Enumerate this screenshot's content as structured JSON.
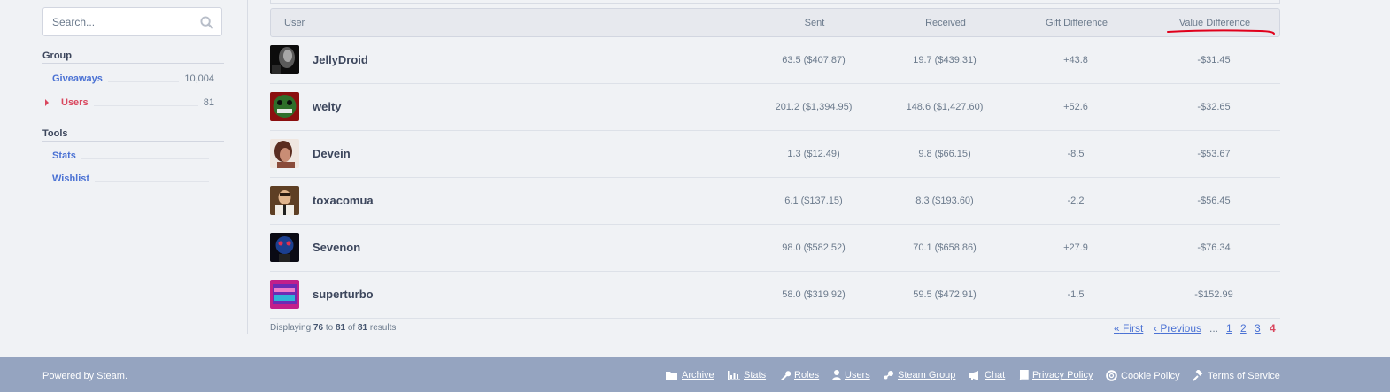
{
  "search": {
    "placeholder": "Search..."
  },
  "sidebar": {
    "group_heading": "Group",
    "group_items": [
      {
        "label": "Giveaways",
        "count": "10,004"
      },
      {
        "label": "Users",
        "count": "81"
      }
    ],
    "tools_heading": "Tools",
    "tools_items": [
      {
        "label": "Stats"
      },
      {
        "label": "Wishlist"
      }
    ]
  },
  "table": {
    "headers": {
      "user": "User",
      "sent": "Sent",
      "received": "Received",
      "gift_difference": "Gift Difference",
      "value_difference": "Value Difference"
    },
    "rows": [
      {
        "user": "JellyDroid",
        "sent": "63.5 ($407.87)",
        "received": "19.7 ($439.31)",
        "gift_diff": "+43.8",
        "value_diff": "-$31.45"
      },
      {
        "user": "weity",
        "sent": "201.2 ($1,394.95)",
        "received": "148.6 ($1,427.60)",
        "gift_diff": "+52.6",
        "value_diff": "-$32.65"
      },
      {
        "user": "Devein",
        "sent": "1.3 ($12.49)",
        "received": "9.8 ($66.15)",
        "gift_diff": "-8.5",
        "value_diff": "-$53.67"
      },
      {
        "user": "toxacomua",
        "sent": "6.1 ($137.15)",
        "received": "8.3 ($193.60)",
        "gift_diff": "-2.2",
        "value_diff": "-$56.45"
      },
      {
        "user": "Sevenon",
        "sent": "98.0 ($582.52)",
        "received": "70.1 ($658.86)",
        "gift_diff": "+27.9",
        "value_diff": "-$76.34"
      },
      {
        "user": "superturbo",
        "sent": "58.0 ($319.92)",
        "received": "59.5 ($472.91)",
        "gift_diff": "-1.5",
        "value_diff": "-$152.99"
      }
    ]
  },
  "results": {
    "prefix": "Displaying",
    "from": "76",
    "to_word": "to",
    "to": "81",
    "of_word": "of",
    "total": "81",
    "suffix": "results"
  },
  "pagination": {
    "first": "First",
    "previous": "Previous",
    "dots": "...",
    "pages": [
      "1",
      "2",
      "3",
      "4"
    ],
    "current": "4"
  },
  "footer": {
    "powered_prefix": "Powered by",
    "powered_link": "Steam",
    "powered_suffix": ".",
    "links": [
      "Archive",
      "Stats",
      "Roles",
      "Users",
      "Steam Group",
      "Chat",
      "Privacy Policy",
      "Cookie Policy",
      "Terms of Service"
    ]
  },
  "icons": {
    "search": "search-icon",
    "archive": "folder-icon",
    "stats": "bar-chart-icon",
    "roles": "wrench-icon",
    "users": "user-icon",
    "steam_group": "steam-icon",
    "chat": "megaphone-icon",
    "privacy": "book-icon",
    "cookie": "lifebuoy-icon",
    "terms": "gavel-icon",
    "first": "double-chevron-left-icon",
    "previous": "chevron-left-icon"
  },
  "colors": {
    "link": "#4b72d4",
    "active": "#d9475e",
    "footer_bg": "#95a4c0",
    "annotation_underline": "#e0001b"
  }
}
